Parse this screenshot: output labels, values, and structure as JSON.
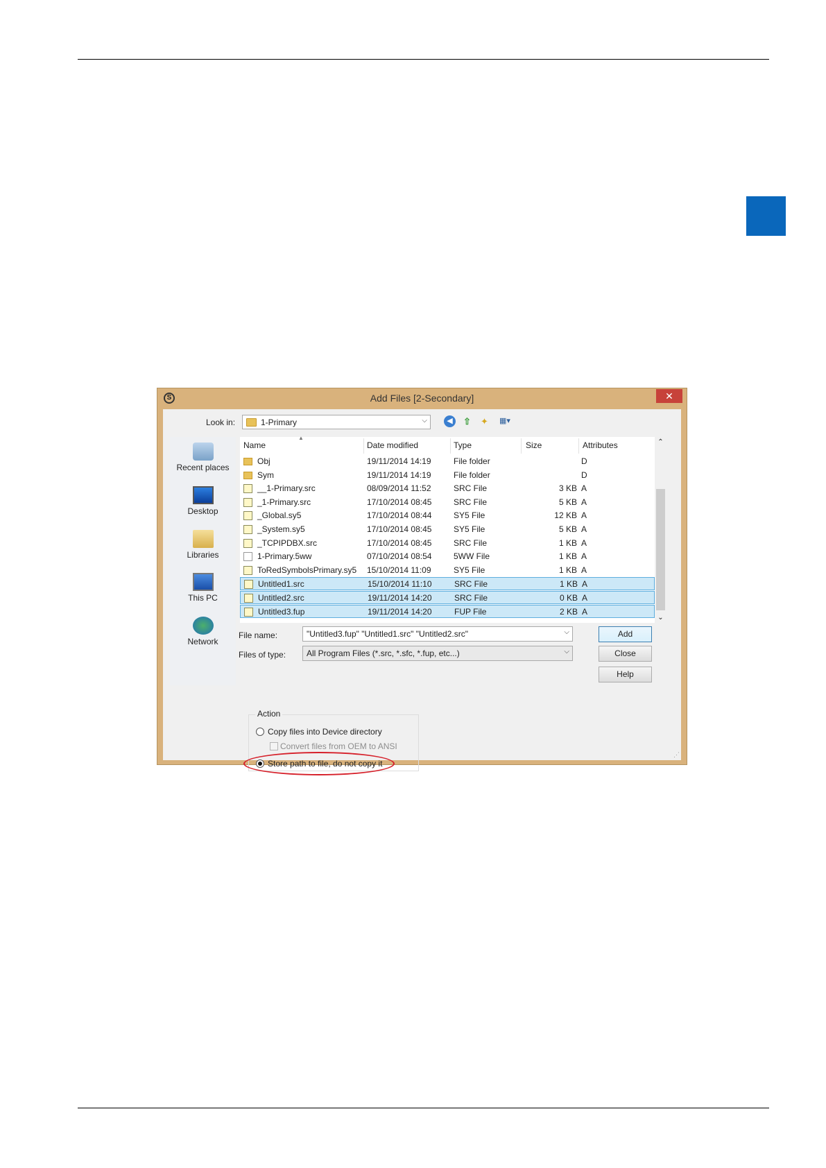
{
  "dialog": {
    "title": "Add Files [2-Secondary]",
    "close_label": "✕",
    "look_in_label": "Look in:",
    "look_in_value": "1-Primary"
  },
  "places": [
    {
      "label": "Recent places"
    },
    {
      "label": "Desktop"
    },
    {
      "label": "Libraries"
    },
    {
      "label": "This PC"
    },
    {
      "label": "Network"
    }
  ],
  "columns": {
    "name": "Name",
    "date": "Date modified",
    "type": "Type",
    "size": "Size",
    "attributes": "Attributes"
  },
  "files": [
    {
      "name": "Obj",
      "date": "19/11/2014 14:19",
      "type": "File folder",
      "size": "",
      "attr": "D",
      "icon": "folder-icon",
      "selected": false
    },
    {
      "name": "Sym",
      "date": "19/11/2014 14:19",
      "type": "File folder",
      "size": "",
      "attr": "D",
      "icon": "folder-icon",
      "selected": false
    },
    {
      "name": "__1-Primary.src",
      "date": "08/09/2014 11:52",
      "type": "SRC File",
      "size": "3 KB",
      "attr": "A",
      "icon": "file-icon",
      "selected": false
    },
    {
      "name": "_1-Primary.src",
      "date": "17/10/2014 08:45",
      "type": "SRC File",
      "size": "5 KB",
      "attr": "A",
      "icon": "file-icon",
      "selected": false
    },
    {
      "name": "_Global.sy5",
      "date": "17/10/2014 08:44",
      "type": "SY5 File",
      "size": "12 KB",
      "attr": "A",
      "icon": "file-icon",
      "selected": false
    },
    {
      "name": "_System.sy5",
      "date": "17/10/2014 08:45",
      "type": "SY5 File",
      "size": "5 KB",
      "attr": "A",
      "icon": "file-icon",
      "selected": false
    },
    {
      "name": "_TCPIPDBX.src",
      "date": "17/10/2014 08:45",
      "type": "SRC File",
      "size": "1 KB",
      "attr": "A",
      "icon": "file-icon",
      "selected": false
    },
    {
      "name": "1-Primary.5ww",
      "date": "07/10/2014 08:54",
      "type": "5WW File",
      "size": "1 KB",
      "attr": "A",
      "icon": "blank-file-icon",
      "selected": false
    },
    {
      "name": "ToRedSymbolsPrimary.sy5",
      "date": "15/10/2014 11:09",
      "type": "SY5 File",
      "size": "1 KB",
      "attr": "A",
      "icon": "file-icon",
      "selected": false
    },
    {
      "name": "Untitled1.src",
      "date": "15/10/2014 11:10",
      "type": "SRC File",
      "size": "1 KB",
      "attr": "A",
      "icon": "file-icon",
      "selected": true
    },
    {
      "name": "Untitled2.src",
      "date": "19/11/2014 14:20",
      "type": "SRC File",
      "size": "0 KB",
      "attr": "A",
      "icon": "file-icon",
      "selected": true
    },
    {
      "name": "Untitled3.fup",
      "date": "19/11/2014 14:20",
      "type": "FUP File",
      "size": "2 KB",
      "attr": "A",
      "icon": "file-icon",
      "selected": true
    }
  ],
  "file_name_label": "File name:",
  "file_name_value": "\"Untitled3.fup\" \"Untitled1.src\" \"Untitled2.src\"",
  "files_of_type_label": "Files of type:",
  "files_of_type_value": "All Program Files (*.src, *.sfc, *.fup, etc...)",
  "buttons": {
    "add": "Add",
    "close": "Close",
    "help": "Help"
  },
  "action": {
    "title": "Action",
    "copy_label": "Copy files into Device directory",
    "convert_label": "Convert files from OEM to ANSI",
    "store_label": "Store path to file, do not copy it",
    "selected_option": "store"
  },
  "colors": {
    "accent_tab": "#0a67bb",
    "selection": "#cce8f7",
    "highlight_ellipse": "#d6202a"
  }
}
